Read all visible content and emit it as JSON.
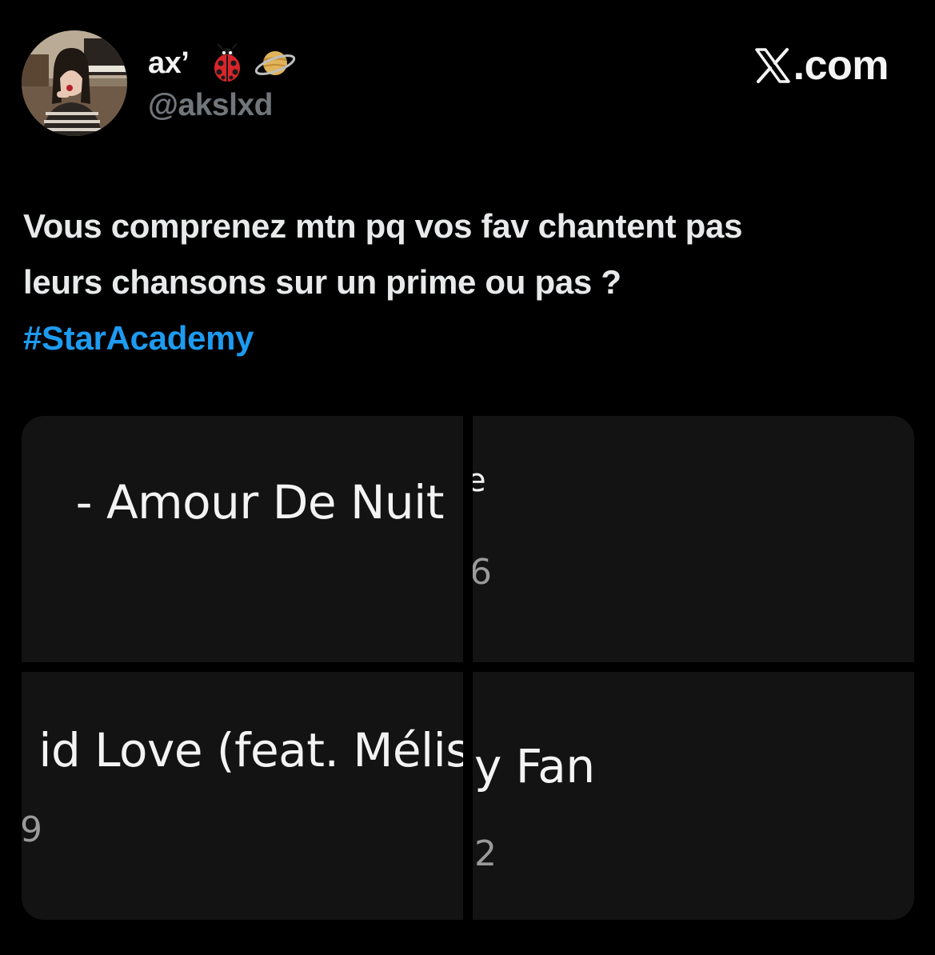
{
  "author": {
    "display_name": "ax’",
    "emojis": [
      "ladybug-icon",
      "ringed-planet-icon"
    ],
    "handle": "@akslxd"
  },
  "brand": {
    "suffix": ".com",
    "icon": "x-logo-icon"
  },
  "tweet": {
    "lines": [
      "Vous comprenez mtn pq vos fav chantent pas",
      "leurs chansons sur un prime ou pas ?"
    ],
    "hashtag": "#StarAcademy"
  },
  "media": [
    {
      "title": "- Amour De Nuit",
      "sub": ""
    },
    {
      "title": "e",
      "sub": "6"
    },
    {
      "title": "id Love (feat. Mélis",
      "sub": "9"
    },
    {
      "title": "y Fan",
      "sub": "2"
    }
  ],
  "colors": {
    "background": "#000000",
    "text": "#e7e9ea",
    "secondary": "#71767b",
    "link": "#1d9bf0",
    "tile": "#131313"
  }
}
